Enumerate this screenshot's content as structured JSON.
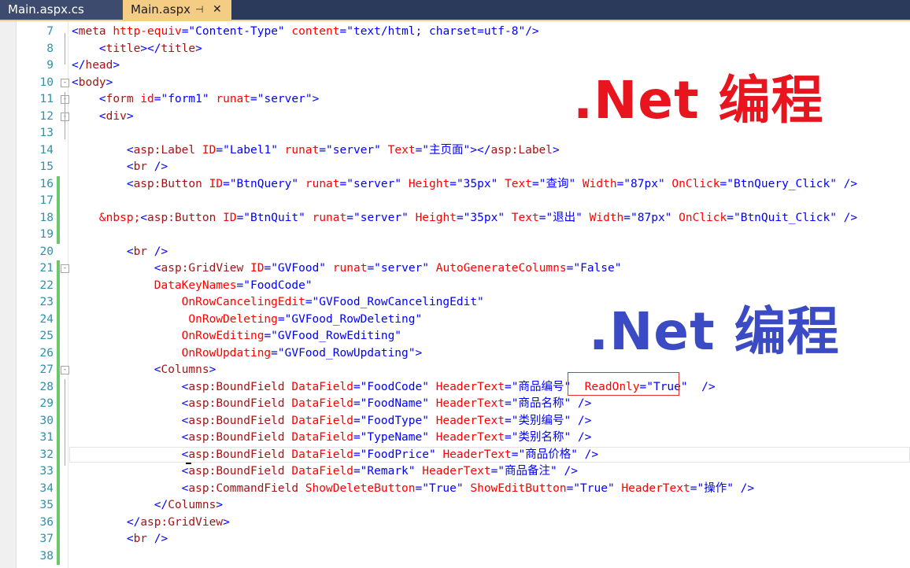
{
  "tabs": [
    {
      "label": "Main.aspx.cs",
      "active": false
    },
    {
      "label": "Main.aspx",
      "active": true,
      "pin": "⊣",
      "close": "✕"
    }
  ],
  "watermarks": [
    ".Net 编程",
    ".Net 编程"
  ],
  "colors": {
    "keyword": "#0000ff",
    "tag": "#a31515",
    "attr": "#ff0000",
    "line_number": "#2b91af",
    "modified": "#6cc66c",
    "tab_active": "#f5cc84"
  },
  "lines": [
    {
      "n": "7",
      "fold": "",
      "mod": false,
      "tokens": [
        [
          "b",
          "<"
        ],
        [
          "m",
          "meta"
        ],
        [
          "b",
          " "
        ],
        [
          "r",
          "http-equiv"
        ],
        [
          "b",
          "=\"Content-Type\" "
        ],
        [
          "r",
          "content"
        ],
        [
          "b",
          "=\"text/html; charset=utf-8\"/>"
        ]
      ]
    },
    {
      "n": "8",
      "fold": "",
      "mod": false,
      "tokens": [
        [
          "b",
          "    <"
        ],
        [
          "m",
          "title"
        ],
        [
          "b",
          "></"
        ],
        [
          "m",
          "title"
        ],
        [
          "b",
          ">"
        ]
      ]
    },
    {
      "n": "9",
      "fold": "",
      "mod": false,
      "tokens": [
        [
          "b",
          "</"
        ],
        [
          "m",
          "head"
        ],
        [
          "b",
          ">"
        ]
      ]
    },
    {
      "n": "10",
      "fold": "-",
      "mod": false,
      "tokens": [
        [
          "b",
          "<"
        ],
        [
          "m",
          "body"
        ],
        [
          "b",
          ">"
        ]
      ]
    },
    {
      "n": "11",
      "fold": "-",
      "mod": false,
      "tokens": [
        [
          "b",
          "    <"
        ],
        [
          "m",
          "form"
        ],
        [
          "b",
          " "
        ],
        [
          "r",
          "id"
        ],
        [
          "b",
          "=\"form1\" "
        ],
        [
          "r",
          "runat"
        ],
        [
          "b",
          "=\"server\">"
        ]
      ]
    },
    {
      "n": "12",
      "fold": "-",
      "mod": false,
      "tokens": [
        [
          "b",
          "    <"
        ],
        [
          "m",
          "div"
        ],
        [
          "b",
          ">"
        ]
      ]
    },
    {
      "n": "13",
      "fold": "",
      "mod": false,
      "tokens": []
    },
    {
      "n": "14",
      "fold": "",
      "mod": false,
      "tokens": [
        [
          "b",
          "        <"
        ],
        [
          "m",
          "asp:Label"
        ],
        [
          "b",
          " "
        ],
        [
          "r",
          "ID"
        ],
        [
          "b",
          "=\"Label1\" "
        ],
        [
          "r",
          "runat"
        ],
        [
          "b",
          "=\"server\" "
        ],
        [
          "r",
          "Text"
        ],
        [
          "b",
          "=\"主页面\"></"
        ],
        [
          "m",
          "asp:Label"
        ],
        [
          "b",
          ">"
        ]
      ]
    },
    {
      "n": "15",
      "fold": "",
      "mod": false,
      "tokens": [
        [
          "b",
          "        <"
        ],
        [
          "m",
          "br"
        ],
        [
          "b",
          " />"
        ]
      ]
    },
    {
      "n": "16",
      "fold": "",
      "mod": true,
      "tokens": [
        [
          "b",
          "        <"
        ],
        [
          "m",
          "asp:Button"
        ],
        [
          "b",
          " "
        ],
        [
          "r",
          "ID"
        ],
        [
          "b",
          "=\"BtnQuery\" "
        ],
        [
          "r",
          "runat"
        ],
        [
          "b",
          "=\"server\" "
        ],
        [
          "r",
          "Height"
        ],
        [
          "b",
          "=\"35px\" "
        ],
        [
          "r",
          "Text"
        ],
        [
          "b",
          "=\"查询\" "
        ],
        [
          "r",
          "Width"
        ],
        [
          "b",
          "=\"87px\" "
        ],
        [
          "r",
          "OnClick"
        ],
        [
          "b",
          "=\"BtnQuery_Click\" />"
        ]
      ]
    },
    {
      "n": "17",
      "fold": "",
      "mod": true,
      "tokens": []
    },
    {
      "n": "18",
      "fold": "",
      "mod": true,
      "tokens": [
        [
          "r",
          "    &nbsp;"
        ],
        [
          "b",
          "<"
        ],
        [
          "m",
          "asp:Button"
        ],
        [
          "b",
          " "
        ],
        [
          "r",
          "ID"
        ],
        [
          "b",
          "=\"BtnQuit\" "
        ],
        [
          "r",
          "runat"
        ],
        [
          "b",
          "=\"server\" "
        ],
        [
          "r",
          "Height"
        ],
        [
          "b",
          "=\"35px\" "
        ],
        [
          "r",
          "Text"
        ],
        [
          "b",
          "=\"退出\" "
        ],
        [
          "r",
          "Width"
        ],
        [
          "b",
          "=\"87px\" "
        ],
        [
          "r",
          "OnClick"
        ],
        [
          "b",
          "=\"BtnQuit_Click\" />"
        ]
      ]
    },
    {
      "n": "19",
      "fold": "",
      "mod": true,
      "tokens": []
    },
    {
      "n": "20",
      "fold": "",
      "mod": false,
      "tokens": [
        [
          "b",
          "        <"
        ],
        [
          "m",
          "br"
        ],
        [
          "b",
          " />"
        ]
      ]
    },
    {
      "n": "21",
      "fold": "-",
      "mod": true,
      "tokens": [
        [
          "b",
          "            <"
        ],
        [
          "m",
          "asp:GridView"
        ],
        [
          "b",
          " "
        ],
        [
          "r",
          "ID"
        ],
        [
          "b",
          "=\"GVFood\" "
        ],
        [
          "r",
          "runat"
        ],
        [
          "b",
          "=\"server\" "
        ],
        [
          "r",
          "AutoGenerateColumns"
        ],
        [
          "b",
          "=\"False\""
        ]
      ]
    },
    {
      "n": "22",
      "fold": "",
      "mod": true,
      "tokens": [
        [
          "r",
          "            DataKeyNames"
        ],
        [
          "b",
          "=\"FoodCode\""
        ]
      ]
    },
    {
      "n": "23",
      "fold": "",
      "mod": true,
      "tokens": [
        [
          "r",
          "                OnRowCancelingEdit"
        ],
        [
          "b",
          "=\"GVFood_RowCancelingEdit\""
        ]
      ]
    },
    {
      "n": "24",
      "fold": "",
      "mod": true,
      "tokens": [
        [
          "r",
          "                 OnRowDeleting"
        ],
        [
          "b",
          "=\"GVFood_RowDeleting\""
        ]
      ]
    },
    {
      "n": "25",
      "fold": "",
      "mod": true,
      "tokens": [
        [
          "r",
          "                OnRowEditing"
        ],
        [
          "b",
          "=\"GVFood_RowEditing\""
        ]
      ]
    },
    {
      "n": "26",
      "fold": "",
      "mod": true,
      "tokens": [
        [
          "r",
          "                OnRowUpdating"
        ],
        [
          "b",
          "=\"GVFood_RowUpdating\">"
        ]
      ]
    },
    {
      "n": "27",
      "fold": "-",
      "mod": true,
      "tokens": [
        [
          "b",
          "            <"
        ],
        [
          "m",
          "Columns"
        ],
        [
          "b",
          ">"
        ]
      ]
    },
    {
      "n": "28",
      "fold": "",
      "mod": true,
      "tokens": [
        [
          "b",
          "                <"
        ],
        [
          "m",
          "asp:BoundField"
        ],
        [
          "b",
          " "
        ],
        [
          "r",
          "DataField"
        ],
        [
          "b",
          "=\"FoodCode\" "
        ],
        [
          "r",
          "HeaderText"
        ],
        [
          "b",
          "=\"商品编号\"  "
        ],
        [
          "r",
          "ReadOnly"
        ],
        [
          "b",
          "=\"True\"  />"
        ]
      ]
    },
    {
      "n": "29",
      "fold": "",
      "mod": true,
      "tokens": [
        [
          "b",
          "                <"
        ],
        [
          "m",
          "asp:BoundField"
        ],
        [
          "b",
          " "
        ],
        [
          "r",
          "DataField"
        ],
        [
          "b",
          "=\"FoodName\" "
        ],
        [
          "r",
          "HeaderText"
        ],
        [
          "b",
          "=\"商品名称\" />"
        ]
      ]
    },
    {
      "n": "30",
      "fold": "",
      "mod": true,
      "tokens": [
        [
          "b",
          "                <"
        ],
        [
          "m",
          "asp:BoundField"
        ],
        [
          "b",
          " "
        ],
        [
          "r",
          "DataField"
        ],
        [
          "b",
          "=\"FoodType\" "
        ],
        [
          "r",
          "HeaderText"
        ],
        [
          "b",
          "=\"类别编号\" />"
        ]
      ]
    },
    {
      "n": "31",
      "fold": "",
      "mod": true,
      "tokens": [
        [
          "b",
          "                <"
        ],
        [
          "m",
          "asp:BoundField"
        ],
        [
          "b",
          " "
        ],
        [
          "r",
          "DataField"
        ],
        [
          "b",
          "=\"TypeName\" "
        ],
        [
          "r",
          "HeaderText"
        ],
        [
          "b",
          "=\"类别名称\" />"
        ]
      ]
    },
    {
      "n": "32",
      "fold": "",
      "mod": true,
      "tokens": [
        [
          "b",
          "                <"
        ],
        [
          "m",
          "asp:BoundField"
        ],
        [
          "b",
          " "
        ],
        [
          "r",
          "DataField"
        ],
        [
          "b",
          "=\"FoodPrice\" "
        ],
        [
          "r",
          "HeaderText"
        ],
        [
          "b",
          "=\"商品价格\" />"
        ]
      ]
    },
    {
      "n": "33",
      "fold": "",
      "mod": true,
      "tokens": [
        [
          "b",
          "                <"
        ],
        [
          "m",
          "asp:BoundField"
        ],
        [
          "b",
          " "
        ],
        [
          "r",
          "DataField"
        ],
        [
          "b",
          "=\"Remark\" "
        ],
        [
          "r",
          "HeaderText"
        ],
        [
          "b",
          "=\"商品备注\" />"
        ]
      ]
    },
    {
      "n": "34",
      "fold": "",
      "mod": true,
      "tokens": [
        [
          "b",
          "                <"
        ],
        [
          "m",
          "asp:CommandField"
        ],
        [
          "b",
          " "
        ],
        [
          "r",
          "ShowDeleteButton"
        ],
        [
          "b",
          "=\"True\" "
        ],
        [
          "r",
          "ShowEditButton"
        ],
        [
          "b",
          "=\"True\" "
        ],
        [
          "r",
          "HeaderText"
        ],
        [
          "b",
          "=\"操作\" />"
        ]
      ]
    },
    {
      "n": "35",
      "fold": "",
      "mod": true,
      "tokens": [
        [
          "b",
          "            </"
        ],
        [
          "m",
          "Columns"
        ],
        [
          "b",
          ">"
        ]
      ]
    },
    {
      "n": "36",
      "fold": "",
      "mod": true,
      "tokens": [
        [
          "b",
          "        </"
        ],
        [
          "m",
          "asp:GridView"
        ],
        [
          "b",
          ">"
        ]
      ]
    },
    {
      "n": "37",
      "fold": "",
      "mod": true,
      "tokens": [
        [
          "b",
          "        <"
        ],
        [
          "m",
          "br"
        ],
        [
          "b",
          " />"
        ]
      ]
    },
    {
      "n": "38",
      "fold": "",
      "mod": true,
      "tokens": []
    }
  ]
}
